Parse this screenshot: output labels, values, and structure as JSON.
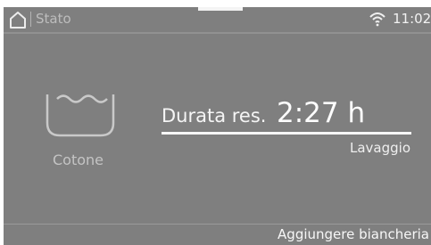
{
  "status_bar": {
    "home_icon": "home-icon",
    "title": "Stato",
    "wifi_icon": "wifi-icon",
    "time": "11:02"
  },
  "program": {
    "icon": "wash-tub-icon",
    "name": "Cotone"
  },
  "remaining": {
    "label": "Durata res.",
    "value": "2:27 h",
    "progress_fraction": 1.0
  },
  "phase": {
    "label": "Lavaggio"
  },
  "footer": {
    "action_label": "Aggiungere biancheria"
  },
  "colors": {
    "screen_background": "#7f7f7f",
    "text_primary": "#f5f5f5",
    "text_muted": "#c4c4c4"
  }
}
